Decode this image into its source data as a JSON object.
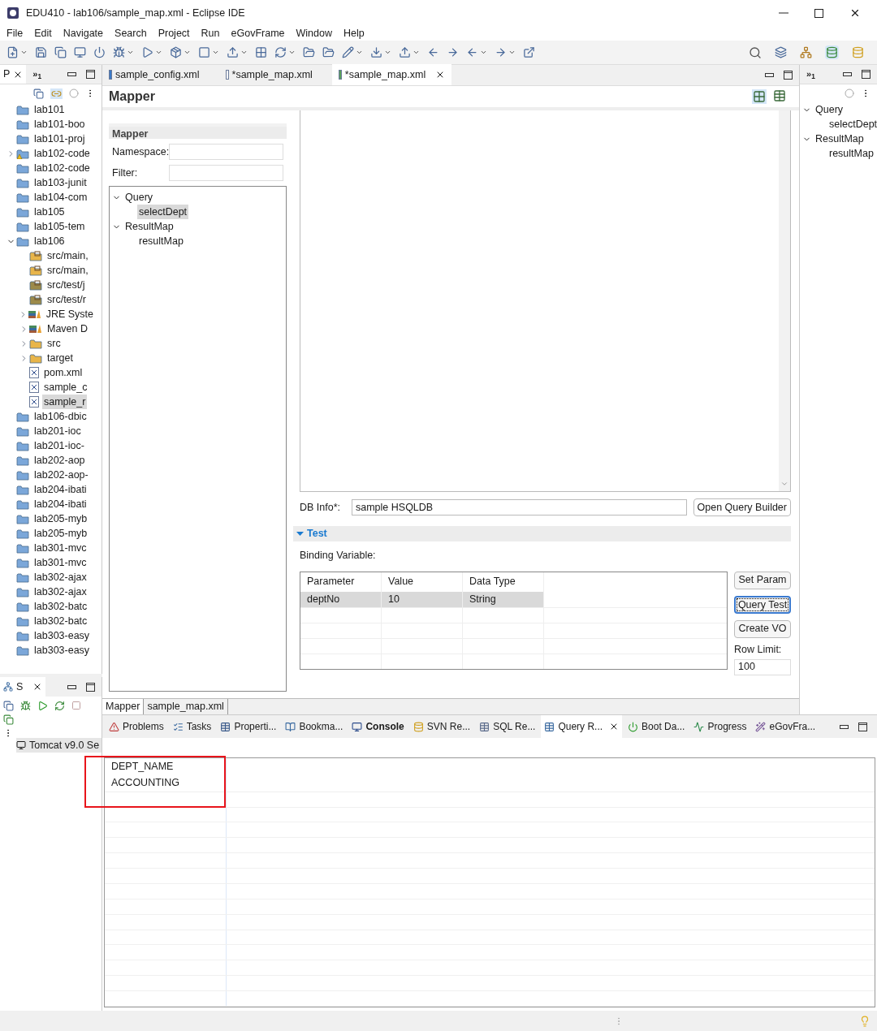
{
  "window": {
    "title": "EDU410 - lab106/sample_map.xml - Eclipse IDE"
  },
  "menu": [
    "File",
    "Edit",
    "Navigate",
    "Search",
    "Project",
    "Run",
    "eGovFrame",
    "Window",
    "Help"
  ],
  "explorer": {
    "tab": "P",
    "overflow": "»$_{1}$",
    "items": [
      {
        "label": "lab101",
        "kind": "project",
        "selected": false
      },
      {
        "label": "lab101-boo",
        "kind": "project",
        "selected": false
      },
      {
        "label": "lab101-proj",
        "kind": "project",
        "selected": false
      },
      {
        "label": "lab102-code",
        "kind": "maven-warning",
        "selected": false,
        "expanded": false
      },
      {
        "label": "lab102-code",
        "kind": "project",
        "selected": false
      },
      {
        "label": "lab103-junit",
        "kind": "project",
        "selected": false
      },
      {
        "label": "lab104-com",
        "kind": "project",
        "selected": false
      },
      {
        "label": "lab105",
        "kind": "project",
        "selected": false
      },
      {
        "label": "lab105-tem",
        "kind": "project",
        "selected": false
      },
      {
        "label": "lab106",
        "kind": "maven",
        "selected": false,
        "expanded": true,
        "children": [
          {
            "label": "src/main,",
            "kind": "source",
            "selected": false
          },
          {
            "label": "src/main,",
            "kind": "source",
            "selected": false
          },
          {
            "label": "src/test/j",
            "kind": "test-source",
            "selected": false
          },
          {
            "label": "src/test/r",
            "kind": "test-source",
            "selected": false
          },
          {
            "label": "JRE Syste",
            "kind": "library",
            "selected": false,
            "expanded": false
          },
          {
            "label": "Maven D",
            "kind": "library",
            "selected": false,
            "expanded": false
          },
          {
            "label": "src",
            "kind": "folder",
            "selected": false,
            "expanded": false
          },
          {
            "label": "target",
            "kind": "folder",
            "selected": false,
            "expanded": false
          },
          {
            "label": "pom.xml",
            "kind": "pom",
            "selected": false
          },
          {
            "label": "sample_c",
            "kind": "xml",
            "selected": false
          },
          {
            "label": "sample_r",
            "kind": "xml",
            "selected": true
          }
        ]
      },
      {
        "label": "lab106-dbic",
        "kind": "project",
        "selected": false
      },
      {
        "label": "lab201-ioc",
        "kind": "project",
        "selected": false
      },
      {
        "label": "lab201-ioc-",
        "kind": "project",
        "selected": false
      },
      {
        "label": "lab202-aop",
        "kind": "project",
        "selected": false
      },
      {
        "label": "lab202-aop-",
        "kind": "project",
        "selected": false
      },
      {
        "label": "lab204-ibati",
        "kind": "project",
        "selected": false
      },
      {
        "label": "lab204-ibati",
        "kind": "project",
        "selected": false
      },
      {
        "label": "lab205-myb",
        "kind": "project",
        "selected": false
      },
      {
        "label": "lab205-myb",
        "kind": "project",
        "selected": false
      },
      {
        "label": "lab301-mvc",
        "kind": "project",
        "selected": false
      },
      {
        "label": "lab301-mvc",
        "kind": "project",
        "selected": false
      },
      {
        "label": "lab302-ajax",
        "kind": "project",
        "selected": false
      },
      {
        "label": "lab302-ajax",
        "kind": "project",
        "selected": false
      },
      {
        "label": "lab302-batc",
        "kind": "project",
        "selected": false
      },
      {
        "label": "lab302-batc",
        "kind": "project",
        "selected": false
      },
      {
        "label": "lab303-easy",
        "kind": "project",
        "selected": false
      },
      {
        "label": "lab303-easy",
        "kind": "project",
        "selected": false
      }
    ]
  },
  "servers": {
    "tab": "S",
    "items": [
      {
        "label": "Tomcat v9.0 Se"
      }
    ]
  },
  "editor": {
    "tabs": [
      {
        "label": "sample_config.xml",
        "kind": "cfg",
        "selected": false
      },
      {
        "label": "*sample_map.xml",
        "kind": "xml",
        "selected": false
      },
      {
        "label": "*sample_map.xml",
        "kind": "map",
        "selected": true
      }
    ],
    "title": "Mapper",
    "mapper": {
      "title": "Mapper",
      "fields": [
        {
          "label": "Namespace:"
        },
        {
          "label": "Filter:"
        }
      ],
      "tree": [
        {
          "label": "Query",
          "expanded": true,
          "selected": false,
          "children": [
            {
              "label": "selectDept",
              "selected": true
            }
          ]
        },
        {
          "label": "ResultMap",
          "expanded": true,
          "selected": false,
          "children": [
            {
              "label": "resultMap",
              "selected": false
            }
          ]
        }
      ]
    },
    "db_info": {
      "label": "DB Info*:",
      "value": "sample HSQLDB",
      "button": "Open Query Builder"
    },
    "test": {
      "title": "Test",
      "expanded": true,
      "binding_label": "Binding Variable:",
      "columns": [
        "Parameter",
        "Value",
        "Data Type"
      ],
      "rows": [
        {
          "cells": [
            "deptNo",
            "10",
            "String"
          ],
          "selected": true
        }
      ],
      "buttons": [
        {
          "label": "Set Param",
          "focused": false
        },
        {
          "label": "Query Test",
          "focused": true
        },
        {
          "label": "Create VO",
          "focused": false
        }
      ],
      "row_limit_label": "Row Limit:",
      "row_limit": "100"
    },
    "page_tabs": [
      {
        "label": "Mapper",
        "selected": true
      },
      {
        "label": "sample_map.xml",
        "selected": false
      }
    ]
  },
  "outline": {
    "overflow": "»$_{1}$",
    "tree": [
      {
        "label": "Query",
        "expanded": true,
        "children": [
          {
            "label": "selectDept"
          }
        ]
      },
      {
        "label": "ResultMap",
        "expanded": true,
        "children": [
          {
            "label": "resultMap"
          }
        ]
      }
    ]
  },
  "bottom": {
    "tabs": [
      {
        "label": "Problems",
        "kind": "problems",
        "selected": false,
        "emphasized": false
      },
      {
        "label": "Tasks",
        "kind": "tasks",
        "selected": false,
        "emphasized": false
      },
      {
        "label": "Properti...",
        "kind": "properties",
        "selected": false,
        "emphasized": false
      },
      {
        "label": "Bookma...",
        "kind": "bookmarks",
        "selected": false,
        "emphasized": false
      },
      {
        "label": "Console",
        "kind": "console",
        "selected": false,
        "emphasized": true
      },
      {
        "label": "SVN Re...",
        "kind": "svn",
        "selected": false,
        "emphasized": false
      },
      {
        "label": "SQL Re...",
        "kind": "sql",
        "selected": false,
        "emphasized": false
      },
      {
        "label": "Query R...",
        "kind": "query",
        "selected": true,
        "emphasized": false
      },
      {
        "label": "Boot Da...",
        "kind": "boot",
        "selected": false,
        "emphasized": false
      },
      {
        "label": "Progress",
        "kind": "progress",
        "selected": false,
        "emphasized": false
      },
      {
        "label": "eGovFra...",
        "kind": "egov",
        "selected": false,
        "emphasized": false
      }
    ],
    "results": {
      "columns": [
        "DEPT_NAME"
      ],
      "rows": [
        [
          "ACCOUNTING"
        ]
      ]
    }
  }
}
